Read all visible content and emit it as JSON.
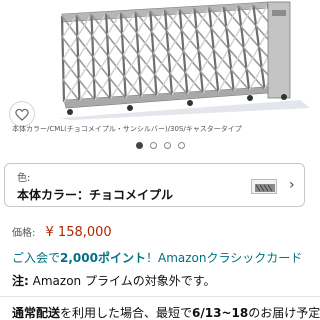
{
  "image": {
    "caption": "本体カラー/CML(チョコメイプル・サンシルバー)/30S/キャスタータイプ",
    "pagination_total": 4,
    "pagination_active_index": 0
  },
  "variant": {
    "label": "色:",
    "value": "本体カラー：チョコメイプル"
  },
  "price": {
    "label": "価格:",
    "value": "¥ 158,000"
  },
  "points": {
    "prefix": "ご入会で",
    "points": "2,000ポイント",
    "suffix": "！Amazonクラシックカード"
  },
  "prime_note": {
    "key": "注:",
    "text": "Amazon プライムの対象外です。"
  },
  "delivery": {
    "key": "通常配送",
    "mid": "を利用した場合、最短で",
    "dates": "6/13~18",
    "tail": "のお届け予定"
  },
  "colors": {
    "price": "#B12704",
    "link": "#007185",
    "gate_frame": "#9a9a9a"
  }
}
